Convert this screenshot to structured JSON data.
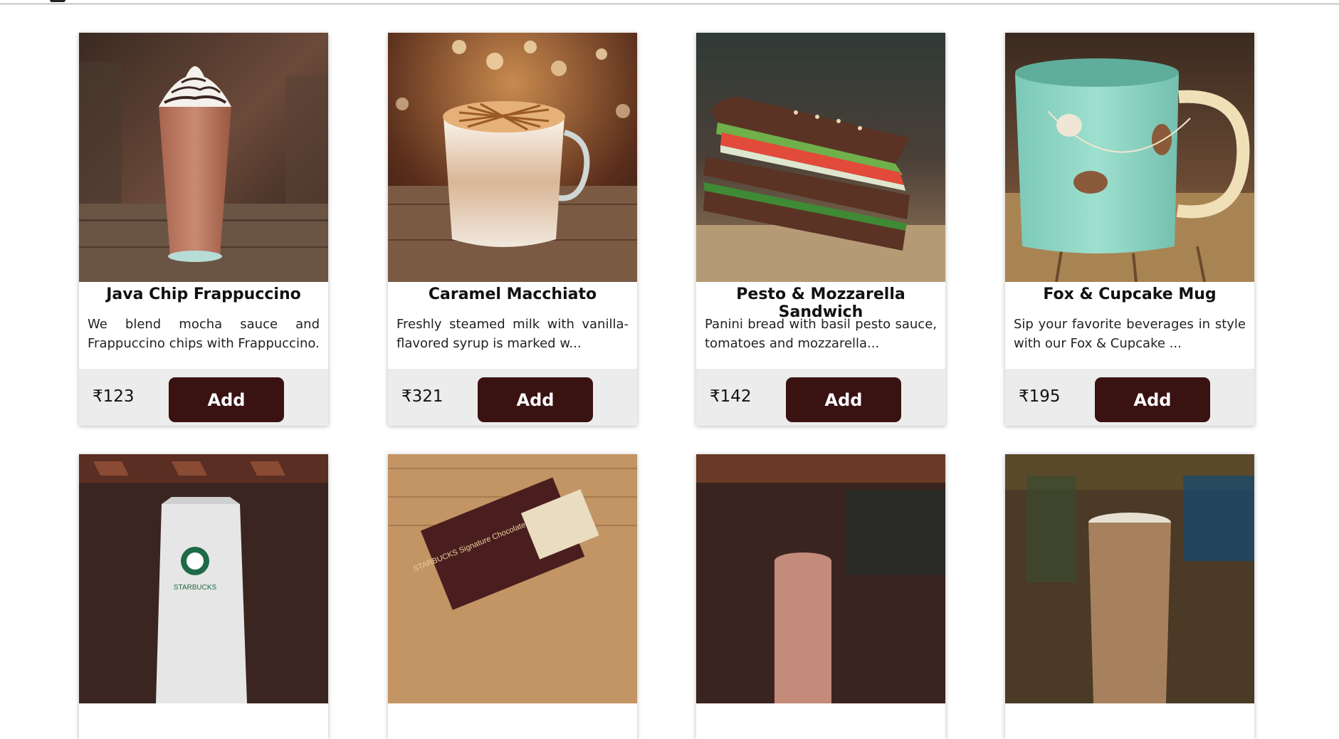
{
  "products": [
    {
      "name": "Java Chip Frappuccino",
      "description": "We blend mocha sauce and Frappuccino chips with Frappuccino.",
      "price": "₹123",
      "add_label": "Add",
      "image": "frappuccino-image"
    },
    {
      "name": "Caramel Macchiato",
      "description": "Freshly steamed milk with vanilla-flavored syrup is marked w...",
      "price": "₹321",
      "add_label": "Add",
      "image": "macchiato-image"
    },
    {
      "name": "Pesto & Mozzarella Sandwich",
      "description": "Panini bread with basil pesto sauce, tomatoes and mozzarella...",
      "price": "₹142",
      "add_label": "Add",
      "image": "sandwich-image"
    },
    {
      "name": "Fox & Cupcake Mug",
      "description": "Sip your favorite beverages in style with our Fox & Cupcake ...",
      "price": "₹195",
      "add_label": "Add",
      "image": "mug-image"
    }
  ],
  "second_row": [
    {
      "image": "coffee-bag-image",
      "package_text": "STARBUCKS"
    },
    {
      "image": "chocolate-box-image",
      "package_text": "STARBUCKS Signature Chocolate"
    },
    {
      "image": "cafe-drink-image"
    },
    {
      "image": "iced-coffee-image"
    }
  ]
}
